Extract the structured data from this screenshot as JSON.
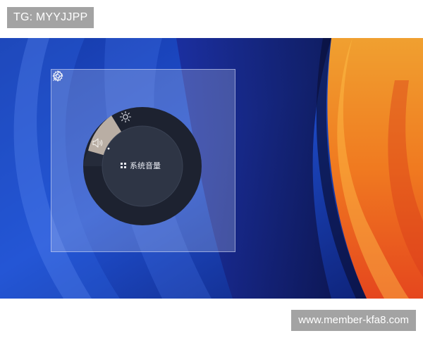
{
  "top_tag": "TG: MYYJJPP",
  "bottom_tag": "www.member-kfa8.com",
  "widget": {
    "pin_icon": "pin-icon",
    "settings_icon": "gear-icon",
    "dial": {
      "segments": [
        {
          "name": "brightness",
          "icon": "sun-icon"
        },
        {
          "name": "volume",
          "icon": "speaker-icon",
          "active": true
        }
      ],
      "center_label": "系统音量",
      "center_icon": "windows-grid-icon"
    }
  },
  "colors": {
    "panel": "#c0c8eb",
    "dial_ring": "#1d2230",
    "dial_active": "#b9aea4",
    "dial_center": "#2a3140"
  }
}
